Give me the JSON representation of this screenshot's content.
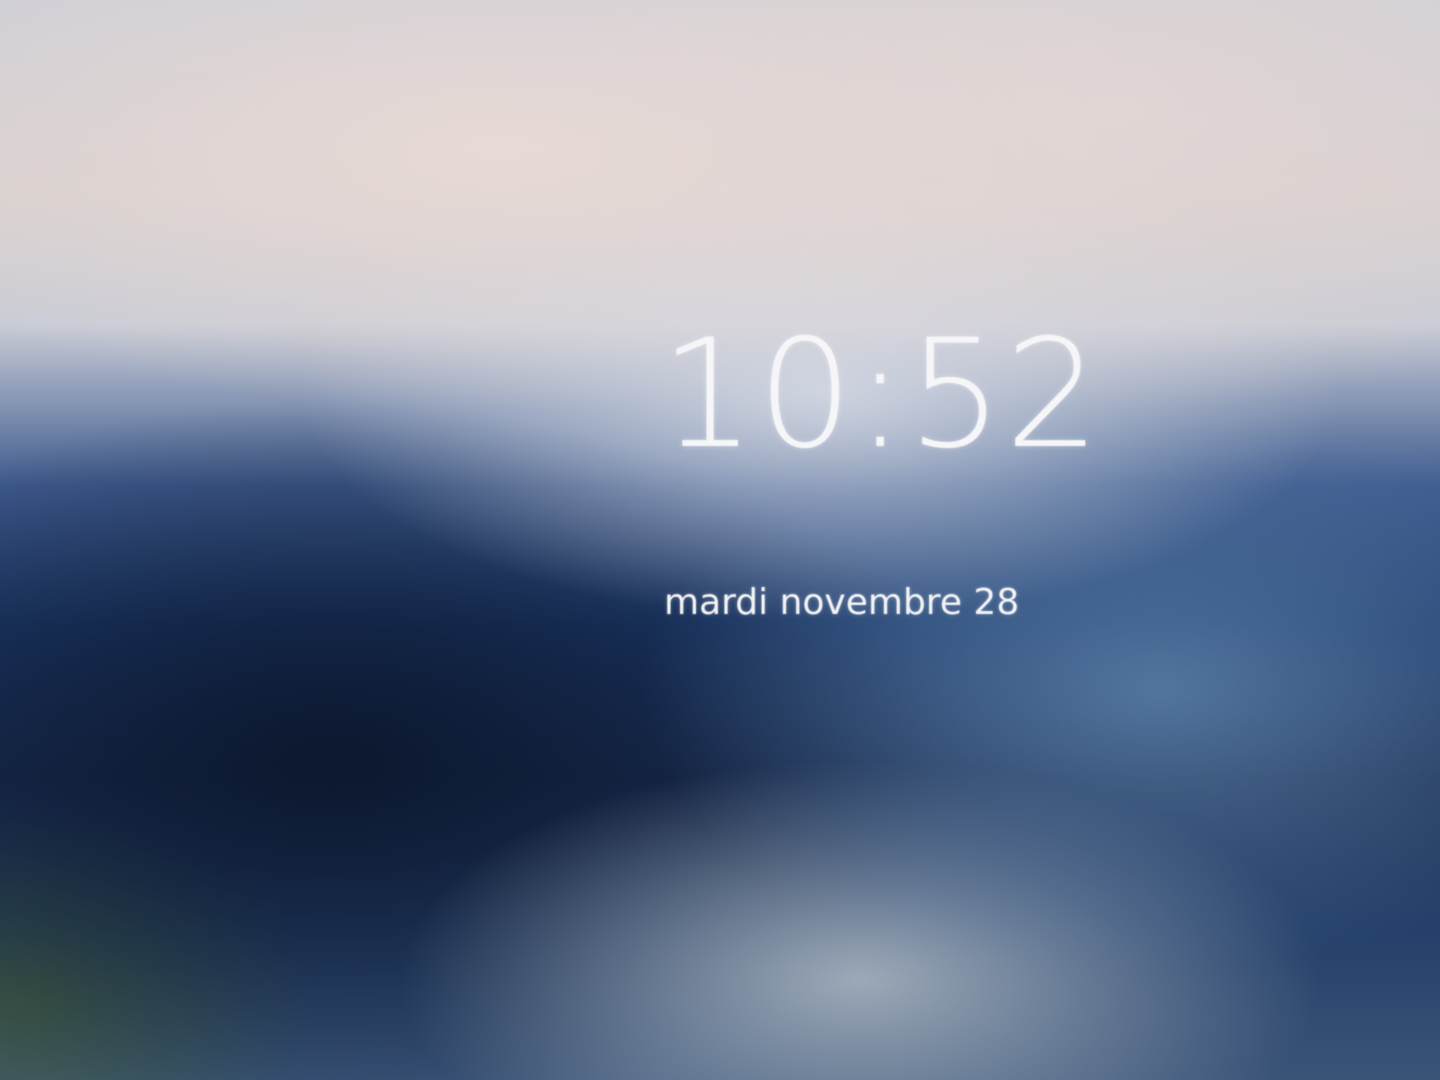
{
  "lock_screen": {
    "time": "10:52",
    "date": "mardi novembre 28"
  },
  "colors": {
    "text": "#f6f6f8",
    "sky_light": "#d7d0cf",
    "deep_blue": "#1d3a6b",
    "dark_navy": "#0b162c"
  }
}
